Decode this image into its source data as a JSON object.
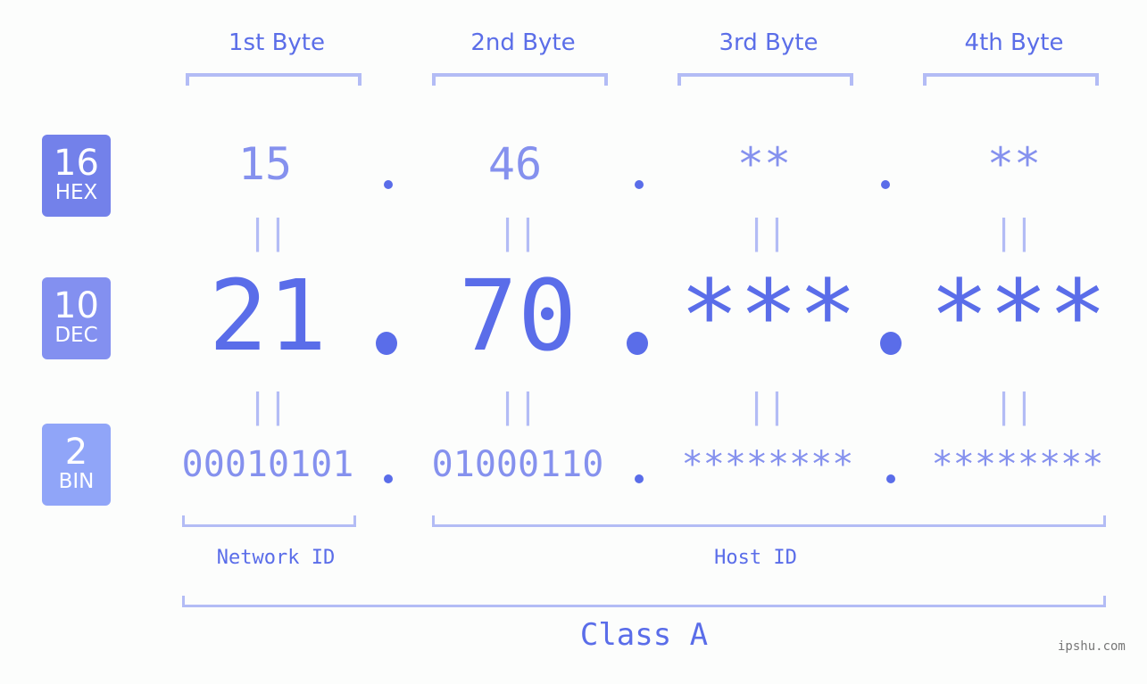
{
  "byte_headers": [
    "1st Byte",
    "2nd Byte",
    "3rd Byte",
    "4th Byte"
  ],
  "badges": {
    "hex": {
      "base": "16",
      "label": "HEX",
      "color": "#7381ea"
    },
    "dec": {
      "base": "10",
      "label": "DEC",
      "color": "#8390f0"
    },
    "bin": {
      "base": "2",
      "label": "BIN",
      "color": "#90a5f8"
    }
  },
  "hex_values": [
    "15",
    "46",
    "**",
    "**"
  ],
  "dec_values": [
    "21",
    "70",
    "***",
    "***"
  ],
  "bin_values": [
    "00010101",
    "01000110",
    "********",
    "********"
  ],
  "equals_symbol": "||",
  "network_id_label": "Network ID",
  "host_id_label": "Host ID",
  "class_label": "Class A",
  "watermark": "ipshu.com",
  "colors": {
    "accent": "#5a6de9",
    "light": "#8591ee",
    "bracket": "#b3bcf5"
  }
}
